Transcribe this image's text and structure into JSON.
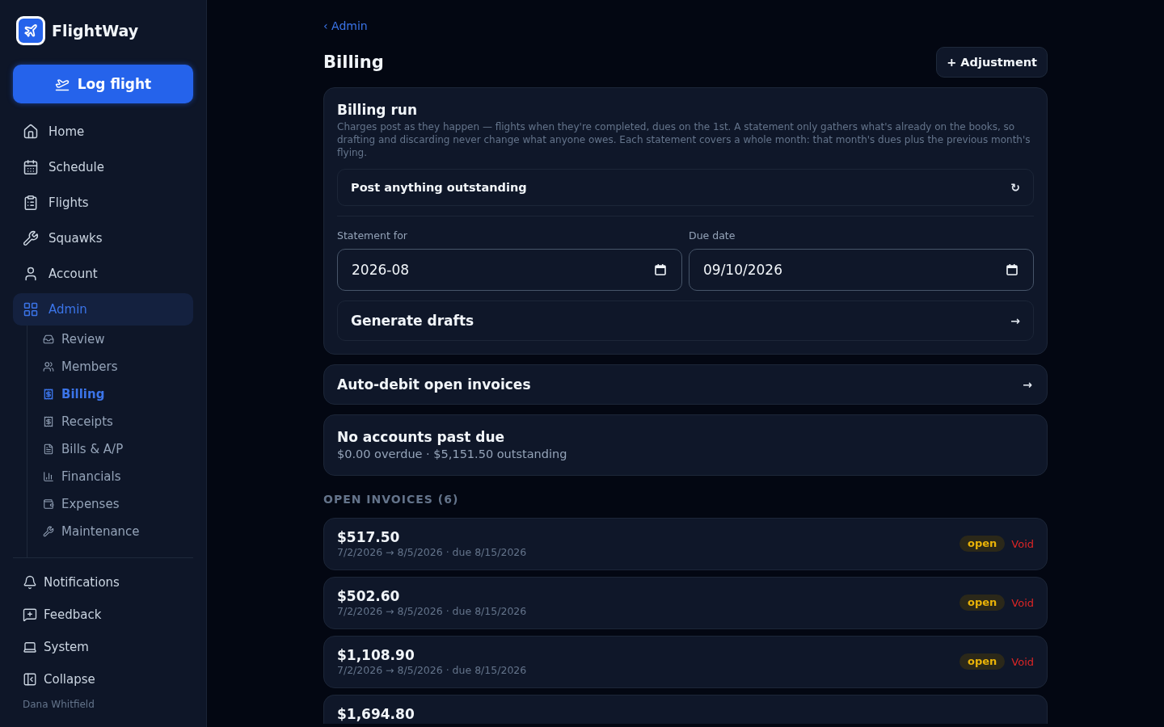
{
  "brand": {
    "name": "FlightWay"
  },
  "sidebar": {
    "primary_action": "Log flight",
    "nav": [
      {
        "label": "Home",
        "selected": false
      },
      {
        "label": "Schedule",
        "selected": false
      },
      {
        "label": "Flights",
        "selected": false
      },
      {
        "label": "Squawks",
        "selected": false
      },
      {
        "label": "Account",
        "selected": false
      },
      {
        "label": "Admin",
        "selected": true,
        "children": [
          {
            "label": "Review",
            "selected": false
          },
          {
            "label": "Members",
            "selected": false
          },
          {
            "label": "Billing",
            "selected": true
          },
          {
            "label": "Receipts",
            "selected": false
          },
          {
            "label": "Bills & A/P",
            "selected": false
          },
          {
            "label": "Financials",
            "selected": false
          },
          {
            "label": "Expenses",
            "selected": false
          },
          {
            "label": "Maintenance",
            "selected": false
          }
        ]
      }
    ],
    "footer_items": [
      {
        "label": "Notifications"
      },
      {
        "label": "Feedback"
      },
      {
        "label": "System"
      },
      {
        "label": "Collapse"
      }
    ],
    "user": "Dana Whitfield"
  },
  "breadcrumb": "‹ Admin",
  "page": {
    "title": "Billing",
    "action": "+ Adjustment"
  },
  "billing_run": {
    "title": "Billing run",
    "description": "Charges post as they happen — flights when they're completed, dues on the 1st. A statement only gathers what's already on the books, so drafting and discarding never change what anyone owes. Each statement covers a whole month: that month's dues plus the previous month's flying.",
    "post_action": {
      "label": "Post anything outstanding",
      "glyph": "↻"
    },
    "fields": [
      {
        "label": "Statement for",
        "value": "2026-08"
      },
      {
        "label": "Due date",
        "value": "09/10/2026"
      }
    ],
    "generate_action": {
      "label": "Generate drafts",
      "glyph": "→"
    }
  },
  "auto_debit": {
    "label": "Auto-debit open invoices",
    "glyph": "→"
  },
  "past_due": {
    "title": "No accounts past due",
    "summary": "$0.00 overdue · $5,151.50 outstanding"
  },
  "open_invoices": {
    "heading": "OPEN INVOICES (6)",
    "items": [
      {
        "amount": "$517.50",
        "period": "7/2/2026 → 8/5/2026 · due 8/15/2026",
        "status": "open",
        "action": "Void"
      },
      {
        "amount": "$502.60",
        "period": "7/2/2026 → 8/5/2026 · due 8/15/2026",
        "status": "open",
        "action": "Void"
      },
      {
        "amount": "$1,108.90",
        "period": "7/2/2026 → 8/5/2026 · due 8/15/2026",
        "status": "open",
        "action": "Void"
      },
      {
        "amount": "$1,694.80"
      }
    ]
  }
}
